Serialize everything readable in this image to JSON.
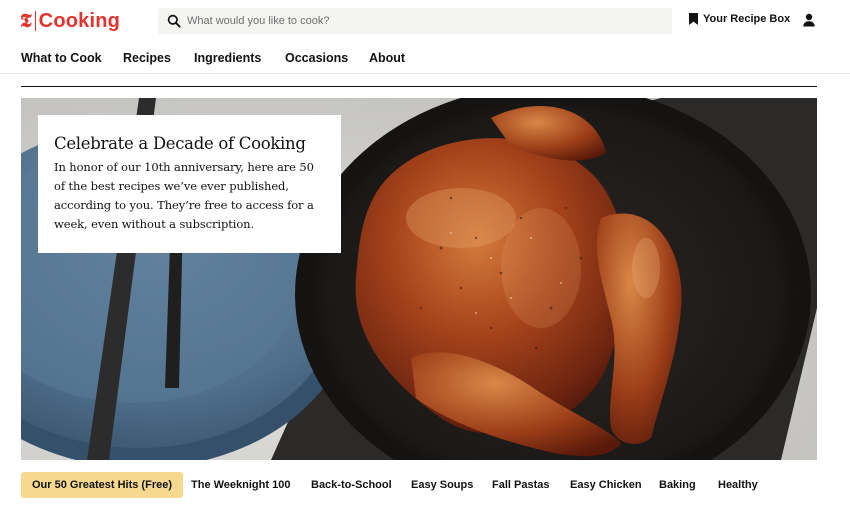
{
  "header": {
    "logo_mark": "𝕿",
    "logo_text": "Cooking",
    "search_placeholder": "What would you like to cook?",
    "recipe_box_label": "Your Recipe Box",
    "brand_color": "#e2342e"
  },
  "nav": {
    "items": [
      {
        "label": "What to Cook"
      },
      {
        "label": "Recipes"
      },
      {
        "label": "Ingredients"
      },
      {
        "label": "Occasions"
      },
      {
        "label": "About"
      }
    ]
  },
  "hero": {
    "title": "Celebrate a Decade of Cooking",
    "body": "In honor of our 10th anniversary, here are 50 of the best recipes we’ve ever published, according to you. They’re free to access for a week, even without a subscription."
  },
  "collections": {
    "active_color": "#f6d88e",
    "items": [
      {
        "label": "Our 50 Greatest Hits (Free)",
        "active": true
      },
      {
        "label": "The Weeknight 100",
        "active": false
      },
      {
        "label": "Back-to-School",
        "active": false
      },
      {
        "label": "Easy Soups",
        "active": false
      },
      {
        "label": "Fall Pastas",
        "active": false
      },
      {
        "label": "Easy Chicken",
        "active": false
      },
      {
        "label": "Baking",
        "active": false
      },
      {
        "label": "Healthy",
        "active": false
      }
    ]
  }
}
